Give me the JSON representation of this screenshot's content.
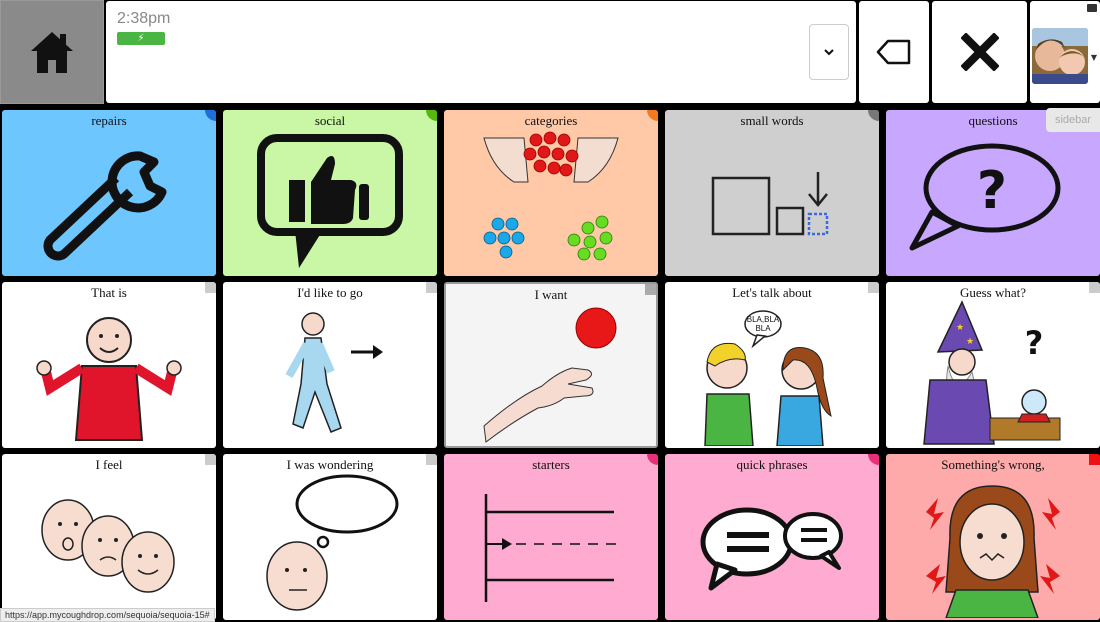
{
  "header": {
    "time": "2:38pm",
    "battery_icon": "lightning-icon",
    "sidebar_label": "sidebar"
  },
  "tiles": [
    {
      "label": "repairs",
      "bg": "#6ec6ff",
      "corner": "#1e6fd9"
    },
    {
      "label": "social",
      "bg": "#c9f7a6",
      "corner": "#56b80f"
    },
    {
      "label": "categories",
      "bg": "#ffc9a8",
      "corner": "#f47a1f"
    },
    {
      "label": "small words",
      "bg": "#cfcfcf",
      "corner": "#777777"
    },
    {
      "label": "questions",
      "bg": "#c8a8ff",
      "corner": "#8a5ae0"
    },
    {
      "label": "That is",
      "bg": "#ffffff",
      "corner": "#cccccc"
    },
    {
      "label": "I'd like to go",
      "bg": "#ffffff",
      "corner": "#cccccc"
    },
    {
      "label": "I want",
      "bg": "#f4f4f4",
      "corner": "#aaaaaa"
    },
    {
      "label": "Let's talk about",
      "bg": "#ffffff",
      "corner": "#cccccc"
    },
    {
      "label": "Guess what?",
      "bg": "#ffffff",
      "corner": "#cccccc"
    },
    {
      "label": "I feel",
      "bg": "#ffffff",
      "corner": "#cccccc"
    },
    {
      "label": "I was wondering",
      "bg": "#ffffff",
      "corner": "#cccccc"
    },
    {
      "label": "starters",
      "bg": "#ffaad0",
      "corner": "#e8307a"
    },
    {
      "label": "quick phrases",
      "bg": "#ffaad0",
      "corner": "#e8307a"
    },
    {
      "label": "Something's wrong,",
      "bg": "#ffaaaa",
      "corner": "#ee1111"
    }
  ],
  "speech_bubble_text": [
    "BLA,BLA",
    "BLA"
  ],
  "status_url": "https://app.mycoughdrop.com/sequoia/sequoia-15#"
}
